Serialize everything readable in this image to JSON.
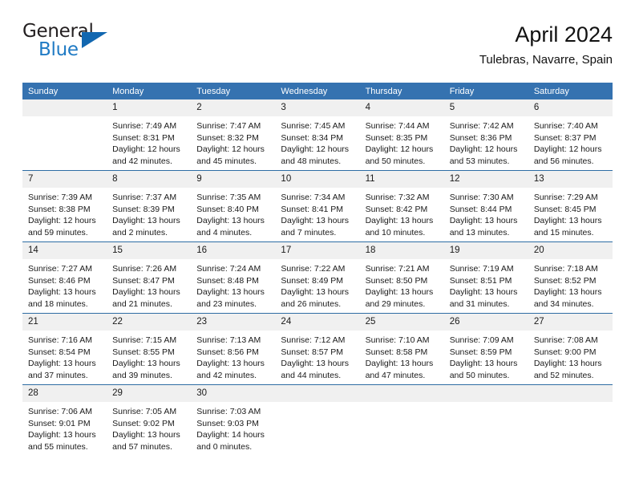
{
  "brand": {
    "name_top": "General",
    "name_bottom": "Blue",
    "triangle_color": "#1267b0",
    "blue_text_color": "#1f7ac4"
  },
  "header": {
    "title": "April 2024",
    "subtitle": "Tulebras, Navarre, Spain",
    "header_bg": "#3572b0",
    "daynum_bg": "#f0f0f0",
    "row_divider": "#2e6da4"
  },
  "weekday_headers": [
    "Sunday",
    "Monday",
    "Tuesday",
    "Wednesday",
    "Thursday",
    "Friday",
    "Saturday"
  ],
  "weeks": [
    [
      {
        "day": "",
        "sunrise": "",
        "sunset": "",
        "daylight_1": "",
        "daylight_2": ""
      },
      {
        "day": "1",
        "sunrise": "Sunrise: 7:49 AM",
        "sunset": "Sunset: 8:31 PM",
        "daylight_1": "Daylight: 12 hours",
        "daylight_2": "and 42 minutes."
      },
      {
        "day": "2",
        "sunrise": "Sunrise: 7:47 AM",
        "sunset": "Sunset: 8:32 PM",
        "daylight_1": "Daylight: 12 hours",
        "daylight_2": "and 45 minutes."
      },
      {
        "day": "3",
        "sunrise": "Sunrise: 7:45 AM",
        "sunset": "Sunset: 8:34 PM",
        "daylight_1": "Daylight: 12 hours",
        "daylight_2": "and 48 minutes."
      },
      {
        "day": "4",
        "sunrise": "Sunrise: 7:44 AM",
        "sunset": "Sunset: 8:35 PM",
        "daylight_1": "Daylight: 12 hours",
        "daylight_2": "and 50 minutes."
      },
      {
        "day": "5",
        "sunrise": "Sunrise: 7:42 AM",
        "sunset": "Sunset: 8:36 PM",
        "daylight_1": "Daylight: 12 hours",
        "daylight_2": "and 53 minutes."
      },
      {
        "day": "6",
        "sunrise": "Sunrise: 7:40 AM",
        "sunset": "Sunset: 8:37 PM",
        "daylight_1": "Daylight: 12 hours",
        "daylight_2": "and 56 minutes."
      }
    ],
    [
      {
        "day": "7",
        "sunrise": "Sunrise: 7:39 AM",
        "sunset": "Sunset: 8:38 PM",
        "daylight_1": "Daylight: 12 hours",
        "daylight_2": "and 59 minutes."
      },
      {
        "day": "8",
        "sunrise": "Sunrise: 7:37 AM",
        "sunset": "Sunset: 8:39 PM",
        "daylight_1": "Daylight: 13 hours",
        "daylight_2": "and 2 minutes."
      },
      {
        "day": "9",
        "sunrise": "Sunrise: 7:35 AM",
        "sunset": "Sunset: 8:40 PM",
        "daylight_1": "Daylight: 13 hours",
        "daylight_2": "and 4 minutes."
      },
      {
        "day": "10",
        "sunrise": "Sunrise: 7:34 AM",
        "sunset": "Sunset: 8:41 PM",
        "daylight_1": "Daylight: 13 hours",
        "daylight_2": "and 7 minutes."
      },
      {
        "day": "11",
        "sunrise": "Sunrise: 7:32 AM",
        "sunset": "Sunset: 8:42 PM",
        "daylight_1": "Daylight: 13 hours",
        "daylight_2": "and 10 minutes."
      },
      {
        "day": "12",
        "sunrise": "Sunrise: 7:30 AM",
        "sunset": "Sunset: 8:44 PM",
        "daylight_1": "Daylight: 13 hours",
        "daylight_2": "and 13 minutes."
      },
      {
        "day": "13",
        "sunrise": "Sunrise: 7:29 AM",
        "sunset": "Sunset: 8:45 PM",
        "daylight_1": "Daylight: 13 hours",
        "daylight_2": "and 15 minutes."
      }
    ],
    [
      {
        "day": "14",
        "sunrise": "Sunrise: 7:27 AM",
        "sunset": "Sunset: 8:46 PM",
        "daylight_1": "Daylight: 13 hours",
        "daylight_2": "and 18 minutes."
      },
      {
        "day": "15",
        "sunrise": "Sunrise: 7:26 AM",
        "sunset": "Sunset: 8:47 PM",
        "daylight_1": "Daylight: 13 hours",
        "daylight_2": "and 21 minutes."
      },
      {
        "day": "16",
        "sunrise": "Sunrise: 7:24 AM",
        "sunset": "Sunset: 8:48 PM",
        "daylight_1": "Daylight: 13 hours",
        "daylight_2": "and 23 minutes."
      },
      {
        "day": "17",
        "sunrise": "Sunrise: 7:22 AM",
        "sunset": "Sunset: 8:49 PM",
        "daylight_1": "Daylight: 13 hours",
        "daylight_2": "and 26 minutes."
      },
      {
        "day": "18",
        "sunrise": "Sunrise: 7:21 AM",
        "sunset": "Sunset: 8:50 PM",
        "daylight_1": "Daylight: 13 hours",
        "daylight_2": "and 29 minutes."
      },
      {
        "day": "19",
        "sunrise": "Sunrise: 7:19 AM",
        "sunset": "Sunset: 8:51 PM",
        "daylight_1": "Daylight: 13 hours",
        "daylight_2": "and 31 minutes."
      },
      {
        "day": "20",
        "sunrise": "Sunrise: 7:18 AM",
        "sunset": "Sunset: 8:52 PM",
        "daylight_1": "Daylight: 13 hours",
        "daylight_2": "and 34 minutes."
      }
    ],
    [
      {
        "day": "21",
        "sunrise": "Sunrise: 7:16 AM",
        "sunset": "Sunset: 8:54 PM",
        "daylight_1": "Daylight: 13 hours",
        "daylight_2": "and 37 minutes."
      },
      {
        "day": "22",
        "sunrise": "Sunrise: 7:15 AM",
        "sunset": "Sunset: 8:55 PM",
        "daylight_1": "Daylight: 13 hours",
        "daylight_2": "and 39 minutes."
      },
      {
        "day": "23",
        "sunrise": "Sunrise: 7:13 AM",
        "sunset": "Sunset: 8:56 PM",
        "daylight_1": "Daylight: 13 hours",
        "daylight_2": "and 42 minutes."
      },
      {
        "day": "24",
        "sunrise": "Sunrise: 7:12 AM",
        "sunset": "Sunset: 8:57 PM",
        "daylight_1": "Daylight: 13 hours",
        "daylight_2": "and 44 minutes."
      },
      {
        "day": "25",
        "sunrise": "Sunrise: 7:10 AM",
        "sunset": "Sunset: 8:58 PM",
        "daylight_1": "Daylight: 13 hours",
        "daylight_2": "and 47 minutes."
      },
      {
        "day": "26",
        "sunrise": "Sunrise: 7:09 AM",
        "sunset": "Sunset: 8:59 PM",
        "daylight_1": "Daylight: 13 hours",
        "daylight_2": "and 50 minutes."
      },
      {
        "day": "27",
        "sunrise": "Sunrise: 7:08 AM",
        "sunset": "Sunset: 9:00 PM",
        "daylight_1": "Daylight: 13 hours",
        "daylight_2": "and 52 minutes."
      }
    ],
    [
      {
        "day": "28",
        "sunrise": "Sunrise: 7:06 AM",
        "sunset": "Sunset: 9:01 PM",
        "daylight_1": "Daylight: 13 hours",
        "daylight_2": "and 55 minutes."
      },
      {
        "day": "29",
        "sunrise": "Sunrise: 7:05 AM",
        "sunset": "Sunset: 9:02 PM",
        "daylight_1": "Daylight: 13 hours",
        "daylight_2": "and 57 minutes."
      },
      {
        "day": "30",
        "sunrise": "Sunrise: 7:03 AM",
        "sunset": "Sunset: 9:03 PM",
        "daylight_1": "Daylight: 14 hours",
        "daylight_2": "and 0 minutes."
      },
      {
        "day": "",
        "sunrise": "",
        "sunset": "",
        "daylight_1": "",
        "daylight_2": ""
      },
      {
        "day": "",
        "sunrise": "",
        "sunset": "",
        "daylight_1": "",
        "daylight_2": ""
      },
      {
        "day": "",
        "sunrise": "",
        "sunset": "",
        "daylight_1": "",
        "daylight_2": ""
      },
      {
        "day": "",
        "sunrise": "",
        "sunset": "",
        "daylight_1": "",
        "daylight_2": ""
      }
    ]
  ]
}
